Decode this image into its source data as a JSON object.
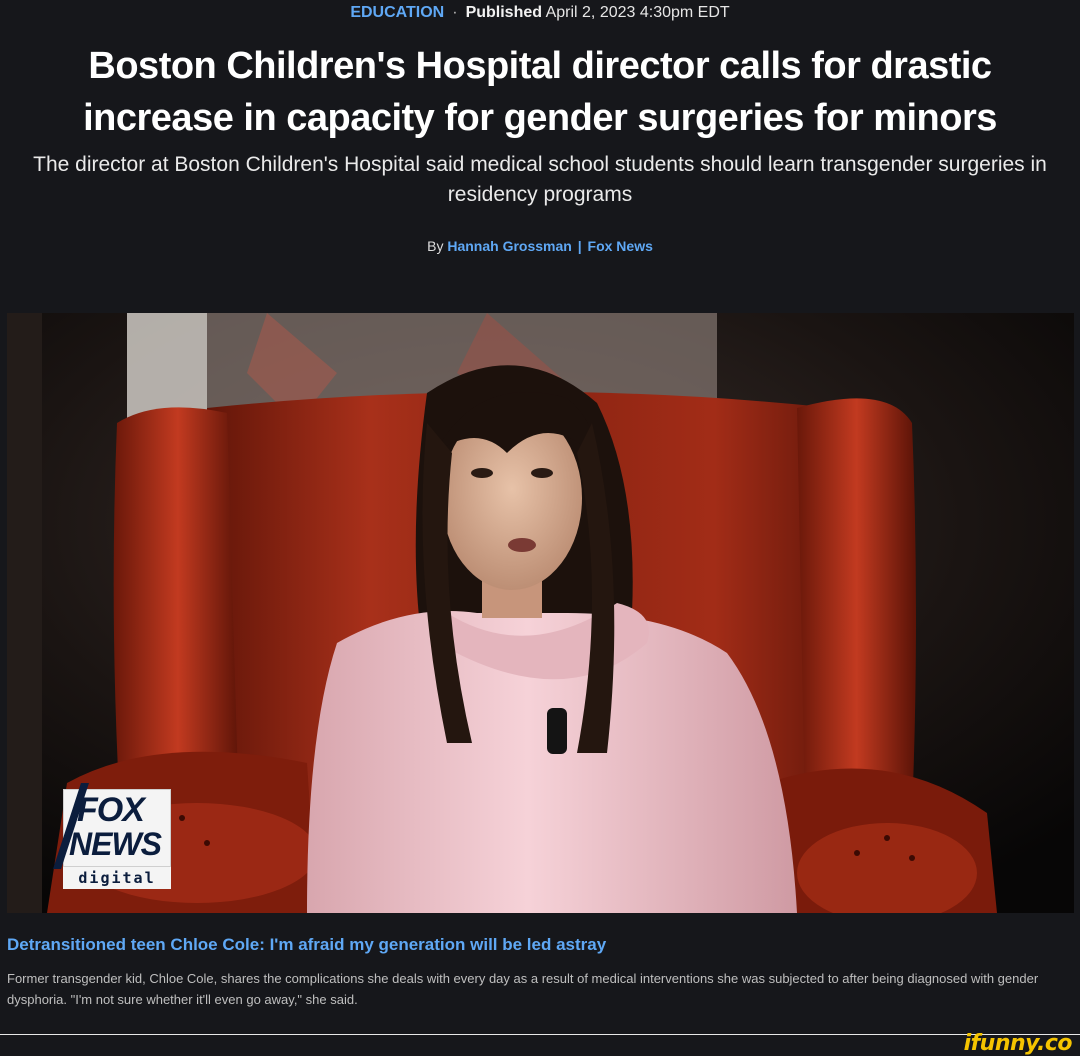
{
  "article": {
    "category": "EDUCATION",
    "separator": "·",
    "published_label": "Published",
    "published_date": "April 2, 2023 4:30pm EDT",
    "headline": "Boston Children's Hospital director calls for drastic increase in capacity for gender surgeries for minors",
    "subheadline": "The director at Boston Children's Hospital said medical school students should learn transgender surgeries in residency programs",
    "byline_prefix": "By",
    "author": "Hannah Grossman",
    "byline_pipe": "|",
    "outlet": "Fox News"
  },
  "media": {
    "logo": {
      "word1": "FOX",
      "word2": "NEWS",
      "word3": "digital"
    },
    "caption_title": "Detransitioned teen Chloe Cole: I'm afraid my generation will be led astray",
    "caption_text": "Former transgender kid, Chloe Cole, shares the complications she deals with every day as a result of medical interventions she was subjected to after being diagnosed with gender dysphoria. \"I'm not sure whether it'll even go away,\" she said."
  },
  "watermark": {
    "text": "ifunny.co"
  },
  "colors": {
    "background": "#16171b",
    "link_blue": "#5fa8f5",
    "watermark_yellow": "#f5c400",
    "chair_red": "#9a2412",
    "hoodie_pink": "#f0c4cc"
  }
}
